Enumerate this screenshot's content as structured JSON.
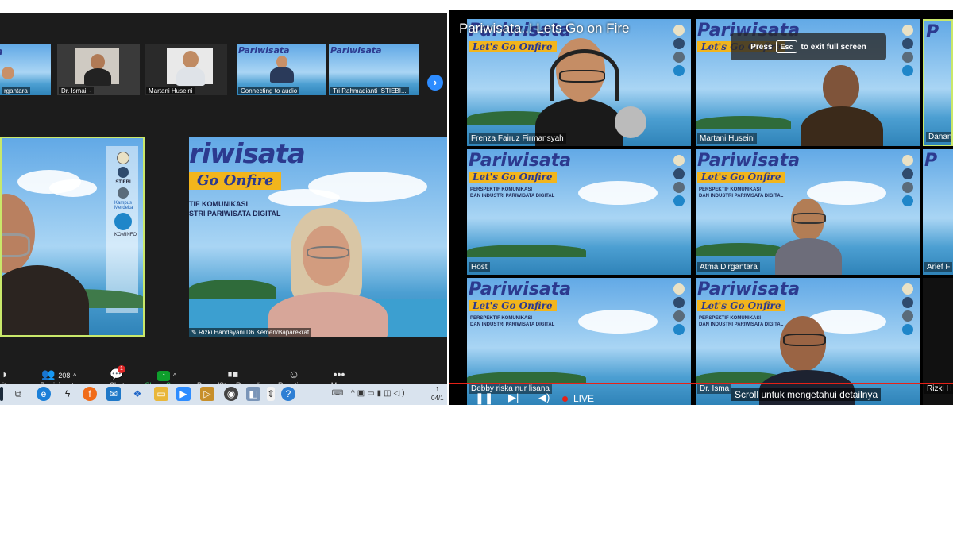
{
  "left_window": {
    "thumbnails": [
      {
        "name": "rgantara"
      },
      {
        "name": "Dr. Ismail -"
      },
      {
        "name": "Martani Huseini"
      },
      {
        "name": "Connecting to audio"
      },
      {
        "name": "Tri Rahmadianti_STIEBI..."
      }
    ],
    "next_page_icon": "chevron-right-icon",
    "speaker_name": "Rizki Handayani D6 Kemen/Baparekraf",
    "slide": {
      "title": "Pariwisata",
      "banner": "Let's Go Onfire",
      "subtitle_line1": "PERSPEKTIF KOMUNIKASI",
      "subtitle_line2": "DAN INDUSTRI PARIWISATA DIGITAL",
      "partial_title": "riwisata",
      "partial_banner": "Go Onfire",
      "partial_sub1": "TIF KOMUNIKASI",
      "partial_sub2": "STRI PARIWISATA DIGITAL",
      "logo_text_1": "STIEBI",
      "logo_text_2": "Kampus Merdeka",
      "logo_text_3": "KOMINFO"
    },
    "toolbar": {
      "security": "rity",
      "participants": "Participants",
      "participants_count": "208",
      "chat": "Chat",
      "chat_badge": "1",
      "share": "Share Screen",
      "recording": "Pause/Stop Recording",
      "reactions": "Reactions",
      "more": "More"
    },
    "taskbar": {
      "time": "1",
      "date": "04/1"
    },
    "colors": {
      "accent": "#2d8cff",
      "share": "#0e9f2c",
      "highlight_border": "#c9e86a"
    }
  },
  "right_window": {
    "title": "Pariwisata..! Lets Go on Fire",
    "escape_tip": {
      "prefix": "Press",
      "key": "Esc",
      "suffix": "to exit full screen"
    },
    "tiles": [
      {
        "name": "Frenza Fairuz Firmansyah"
      },
      {
        "name": "Martani Huseini"
      },
      {
        "name": "Danang"
      },
      {
        "name": "Host"
      },
      {
        "name": "Atma Dirgantara"
      },
      {
        "name": "Arief F"
      },
      {
        "name": "Debby riska nur lisana"
      },
      {
        "name": "Dr. Isma"
      },
      {
        "name": "Rizki H"
      }
    ],
    "live_label": "LIVE",
    "caption": "Scroll untuk mengetahui detailnya"
  }
}
